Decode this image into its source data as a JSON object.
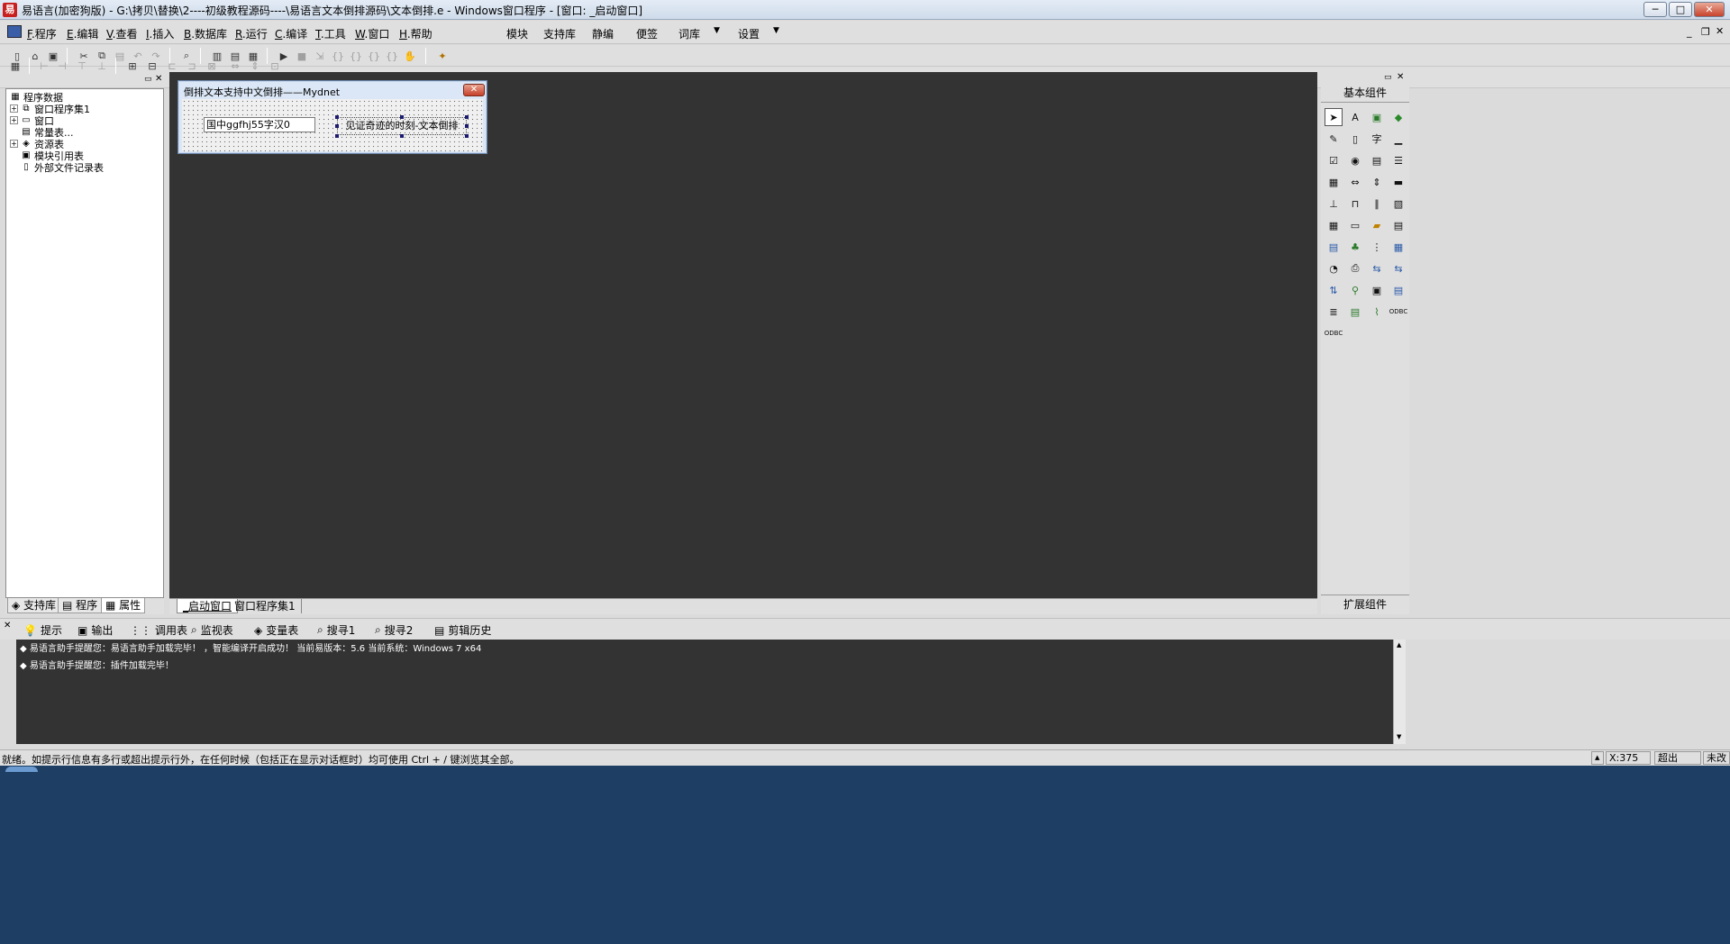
{
  "window": {
    "title": "易语言(加密狗版) - G:\\拷贝\\替换\\2----初级教程源码----\\易语言文本倒排源码\\文本倒排.e - Windows窗口程序 - [窗口: _启动窗口]",
    "min": "─",
    "max": "□",
    "close": "✕"
  },
  "menu": [
    {
      "key": "F",
      "label": ".程序"
    },
    {
      "key": "E",
      "label": ".编辑"
    },
    {
      "key": "V",
      "label": ".查看"
    },
    {
      "key": "I",
      "label": ".插入"
    },
    {
      "key": "B",
      "label": ".数据库"
    },
    {
      "key": "R",
      "label": ".运行"
    },
    {
      "key": "C",
      "label": ".编译"
    },
    {
      "key": "T",
      "label": ".工具"
    },
    {
      "key": "W",
      "label": ".窗口"
    },
    {
      "key": "H",
      "label": ".帮助"
    }
  ],
  "menu_right": [
    "模块",
    "支持库",
    "静编",
    "便签",
    "词库",
    "设置"
  ],
  "tree": {
    "root": "程序数据",
    "items": [
      "窗口程序集1",
      "窗口",
      "常量表...",
      "资源表",
      "模块引用表",
      "外部文件记录表"
    ]
  },
  "left_tabs": [
    "支持库",
    "程序",
    "属性"
  ],
  "form": {
    "title": "倒排文本支持中文倒排——Mydnet",
    "edit_text": "国中ggfhj55字汉0",
    "label_text": "见证奇迹的时刻-文本倒排",
    "close": "✕"
  },
  "doc_tabs": [
    "_启动窗口",
    "窗口程序集1"
  ],
  "components": {
    "header": "基本组件",
    "footer": "扩展组件"
  },
  "output_tabs": [
    "提示",
    "输出",
    "调用表",
    "监视表",
    "变量表",
    "搜寻1",
    "搜寻2",
    "剪辑历史"
  ],
  "output_lines": [
    "易语言助手提醒您：易语言助手加载完毕！ ，智能编译开启成功！ 当前易版本：5.6 当前系统：Windows 7 x64",
    "易语言助手提醒您：插件加载完毕！"
  ],
  "status": {
    "text": "就绪。如提示行信息有多行或超出提示行外，在任何时候（包括正在显示对话框时）均可使用 Ctrl + / 键浏览其全部。",
    "x": "X:375",
    "overwrite": "超出",
    "modified": "未改"
  }
}
